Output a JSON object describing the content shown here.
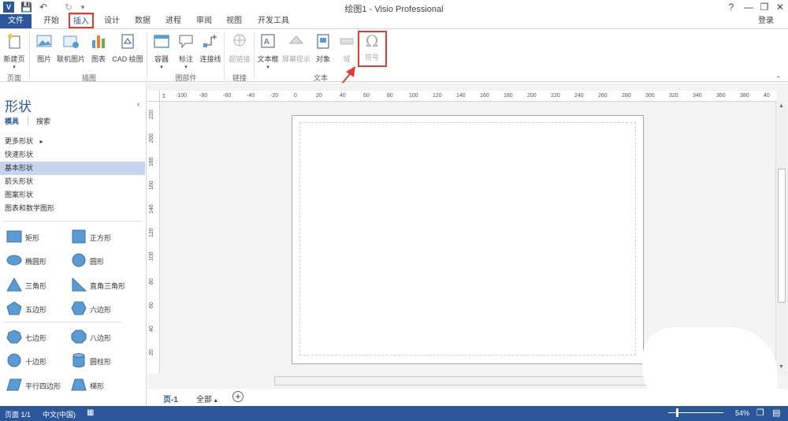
{
  "window": {
    "title": "绘图1 - Visio Professional",
    "help": "?",
    "sign_in": "登录"
  },
  "tabs": [
    "文件",
    "开始",
    "插入",
    "设计",
    "数据",
    "进程",
    "审阅",
    "视图",
    "开发工具"
  ],
  "ribbon": {
    "groups": {
      "page": "页面",
      "illustrations": "插图",
      "diagram_parts": "图部件",
      "links": "链接",
      "text": "文本"
    },
    "buttons": {
      "new_page": "新建页",
      "picture": "图片",
      "online_picture": "联机图片",
      "chart": "图表",
      "cad": "CAD 绘图",
      "container": "容器",
      "callout": "标注",
      "connector": "连接线",
      "hyperlink": "超链接",
      "textbox": "文本框",
      "screentip": "屏幕提示",
      "object": "对象",
      "field": "域",
      "symbol": "符号"
    },
    "symbol_glyph": "Ω"
  },
  "shapes_panel": {
    "title": "形状",
    "tab_stencils": "模具",
    "tab_search": "搜索",
    "more_shapes": "更多形状",
    "categories": [
      "快速形状",
      "基本形状",
      "箭头形状",
      "图案形状",
      "图表和数学图形"
    ],
    "selected_category": "基本形状",
    "shapes": [
      "矩形",
      "正方形",
      "椭圆形",
      "圆形",
      "三角形",
      "直角三角形",
      "五边形",
      "六边形",
      "七边形",
      "八边形",
      "十边形",
      "圆柱形",
      "平行四边形",
      "梯形"
    ]
  },
  "ruler": {
    "h_labels": [
      "-100",
      "-80",
      "-60",
      "-40",
      "-20",
      "0",
      "20",
      "40",
      "60",
      "80",
      "100",
      "120",
      "140",
      "160",
      "180",
      "200",
      "220",
      "240",
      "260",
      "280",
      "300",
      "320",
      "340",
      "360",
      "380",
      "40"
    ],
    "v_labels": [
      "220",
      "200",
      "180",
      "160",
      "140",
      "120",
      "100",
      "80",
      "60",
      "40",
      "20"
    ]
  },
  "page_tabs": {
    "current": "页-1",
    "all": "全部",
    "add": "+"
  },
  "status": {
    "page": "页面 1/1",
    "language": "中文(中国)",
    "zoom": "54%"
  },
  "colors": {
    "accent": "#2b579a",
    "highlight_red": "#e03c31",
    "shape_fill": "#5b9bd5",
    "selected_item": "#c5d4ef"
  }
}
